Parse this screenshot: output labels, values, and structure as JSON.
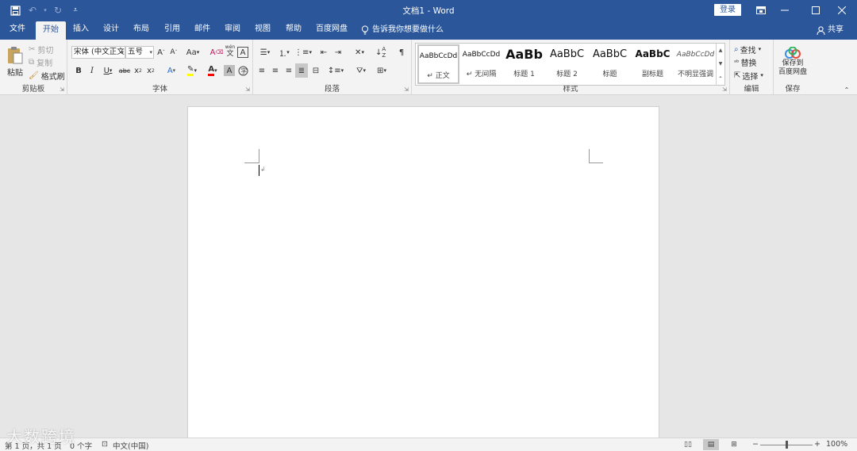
{
  "window": {
    "title": "文档1  -  Word",
    "login_label": "登录",
    "controls": [
      "ribbon-options",
      "minimize",
      "maximize",
      "close"
    ]
  },
  "quick_access": {
    "save": "save-icon",
    "undo": "undo-icon",
    "redo": "redo-icon",
    "customize": "customize-icon"
  },
  "tabs": [
    {
      "label": "文件"
    },
    {
      "label": "开始",
      "active": true
    },
    {
      "label": "插入"
    },
    {
      "label": "设计"
    },
    {
      "label": "布局"
    },
    {
      "label": "引用"
    },
    {
      "label": "邮件"
    },
    {
      "label": "审阅"
    },
    {
      "label": "视图"
    },
    {
      "label": "帮助"
    },
    {
      "label": "百度网盘"
    }
  ],
  "tell_me": "告诉我你想要做什么",
  "share": "共享",
  "clipboard": {
    "label": "剪贴板",
    "paste": "粘贴",
    "cut": "剪切",
    "copy": "复制",
    "format_painter": "格式刷"
  },
  "font": {
    "label": "字体",
    "font_name": "宋体 (中文正文",
    "font_size": "五号"
  },
  "paragraph": {
    "label": "段落"
  },
  "styles": {
    "label": "样式",
    "items": [
      {
        "sample": "AaBbCcDd",
        "name": "↵ 正文"
      },
      {
        "sample": "AaBbCcDd",
        "name": "↵ 无间隔"
      },
      {
        "sample": "AaBb",
        "name": "标题 1"
      },
      {
        "sample": "AaBbC",
        "name": "标题 2"
      },
      {
        "sample": "AaBbC",
        "name": "标题"
      },
      {
        "sample": "AaBbC",
        "name": "副标题"
      },
      {
        "sample": "AaBbCcDd",
        "name": "不明显强调"
      }
    ]
  },
  "editing": {
    "label": "编辑",
    "find": "查找",
    "replace": "替换",
    "select": "选择"
  },
  "save_group": {
    "label": "保存",
    "save_to_line1": "保存到",
    "save_to_line2": "百度网盘"
  },
  "status": {
    "page": "第 1 页，共 1 页",
    "words": "0 个字",
    "language": "中文(中国)",
    "zoom": "100%"
  },
  "zoom_level": 0.5,
  "watermark": "大数跨境",
  "colors": {
    "accent": "#2b579a",
    "highlight": "#ffff00",
    "font_color": "#ff0000"
  }
}
